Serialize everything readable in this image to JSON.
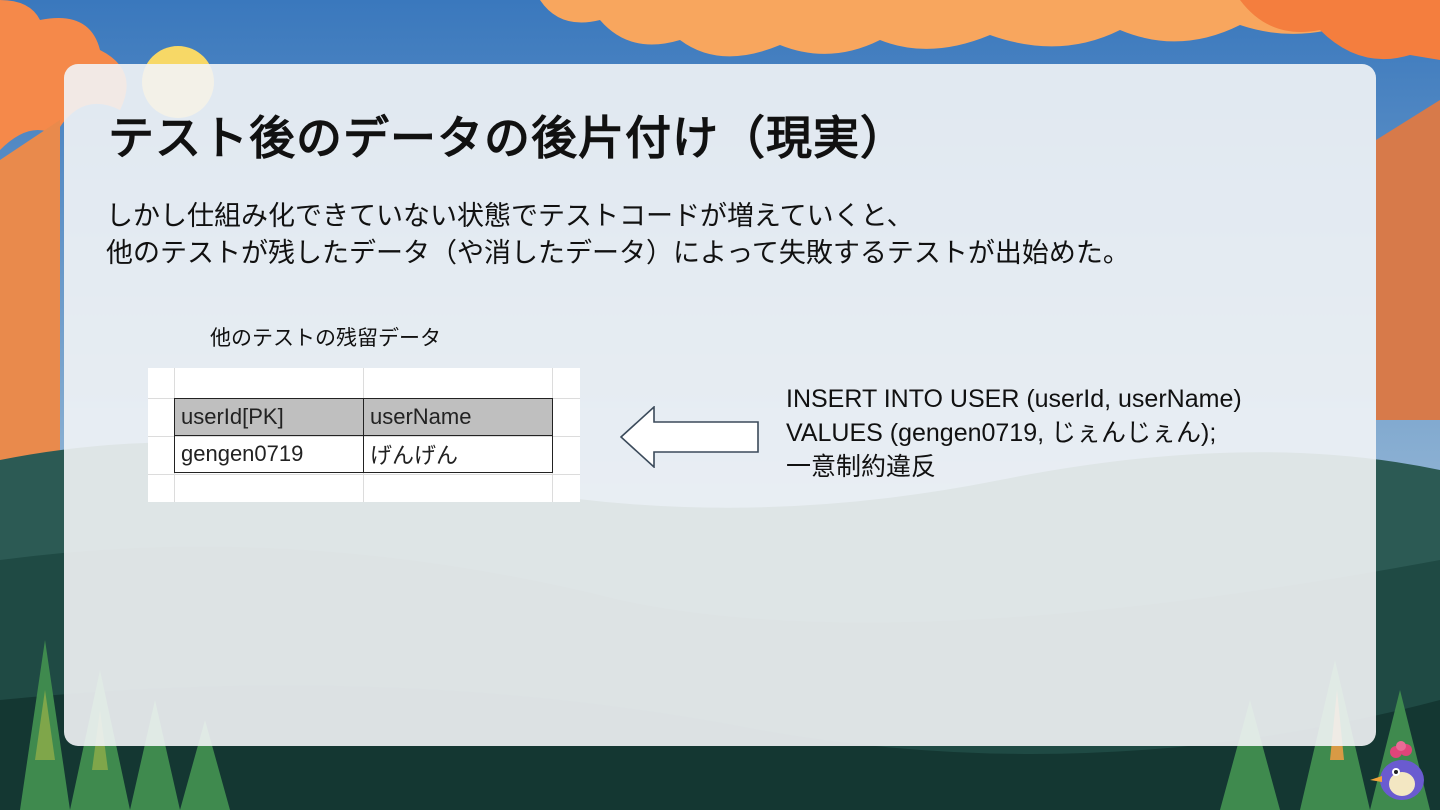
{
  "slide": {
    "title": "テスト後のデータの後片付け（現実）",
    "description": [
      "しかし仕組み化できていない状態でテストコードが増えていくと、",
      "他のテストが残したデータ（や消したデータ）によって失敗するテストが出始めた。"
    ],
    "table_caption": "他のテストの残留データ",
    "table": {
      "headers": [
        "userId[PK]",
        "userName"
      ],
      "rows": [
        [
          "gengen0719",
          "げんげん"
        ]
      ]
    },
    "sql_lines": [
      "INSERT INTO USER (userId, userName)",
      "VALUES (gengen0719, じぇんじぇん);",
      "一意制約違反"
    ]
  },
  "colors": {
    "sky_top": "#3f7fc0",
    "cloud_orange": "#f6a15a",
    "forest_dark": "#1f4a44",
    "card_bg": "#f2f4f6",
    "table_header": "#bfbfbf"
  },
  "icons": {
    "arrow": "left-arrow-icon",
    "mascot": "bird-mascot-icon"
  }
}
